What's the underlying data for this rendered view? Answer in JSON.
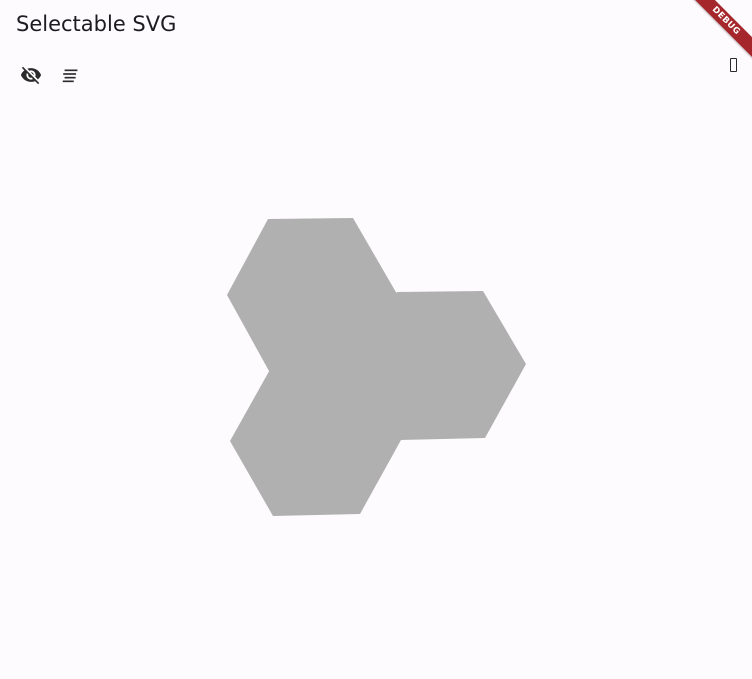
{
  "app": {
    "title": "Selectable SVG"
  },
  "toolbar": {
    "buttons": [
      {
        "icon": "visibility-off-icon"
      },
      {
        "icon": "sort-lines-icon"
      }
    ]
  },
  "banner": {
    "label": "DEBUG",
    "color": "#a5262b"
  },
  "svg_canvas": {
    "shape_color": "#b0b0b0",
    "shapes": [
      {
        "name": "hexagon-top-left"
      },
      {
        "name": "hexagon-right"
      },
      {
        "name": "hexagon-bottom-left"
      }
    ]
  }
}
